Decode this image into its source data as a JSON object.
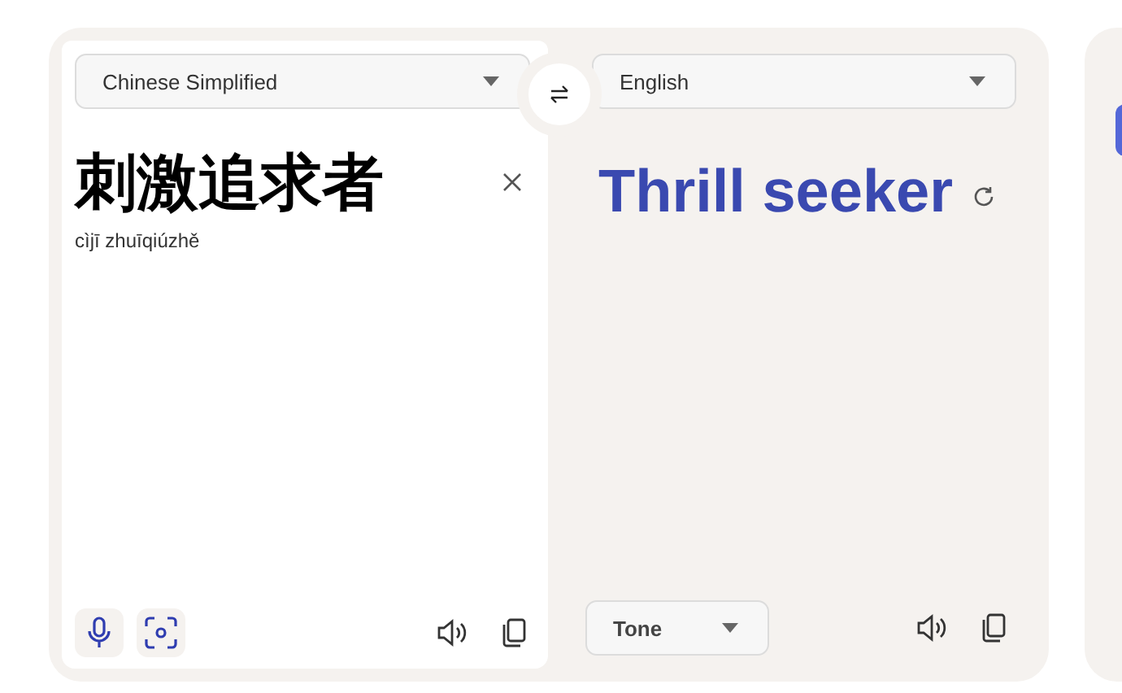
{
  "source": {
    "language": "Chinese Simplified",
    "text": "刺激追求者",
    "romanization": "cìjī zhuīqiúzhě"
  },
  "target": {
    "language": "English",
    "text": "Thrill seeker",
    "tone_select": "Tone"
  }
}
